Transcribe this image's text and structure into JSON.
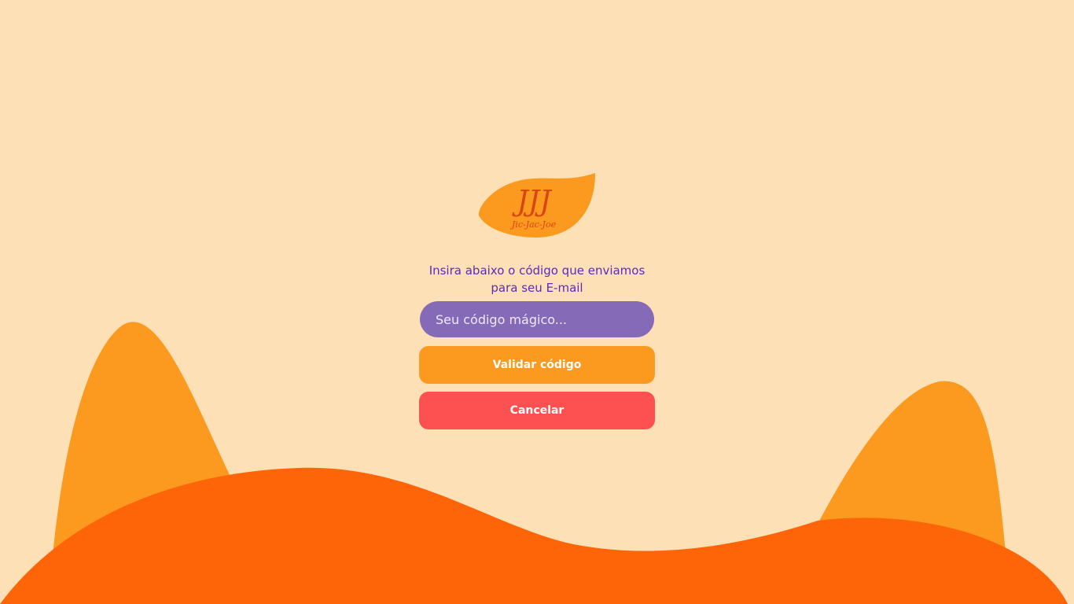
{
  "colors": {
    "background": "#fde0b6",
    "accent_orange": "#fc991f",
    "dark_orange": "#fd6508",
    "purple_text": "#5a2ac2",
    "input_bg": "#856ab7",
    "cancel_red": "#fd5151"
  },
  "logo": {
    "mark": "JJJ",
    "wordmark": "Jic-Jac-Joe",
    "icon": "leaf-logo-icon"
  },
  "instructions": {
    "line1": "Insira abaixo o código que enviamos",
    "line2": "para seu E-mail"
  },
  "code_input": {
    "value": "",
    "placeholder": "Seu código mágico..."
  },
  "buttons": {
    "validate_label": "Validar código",
    "cancel_label": "Cancelar"
  }
}
